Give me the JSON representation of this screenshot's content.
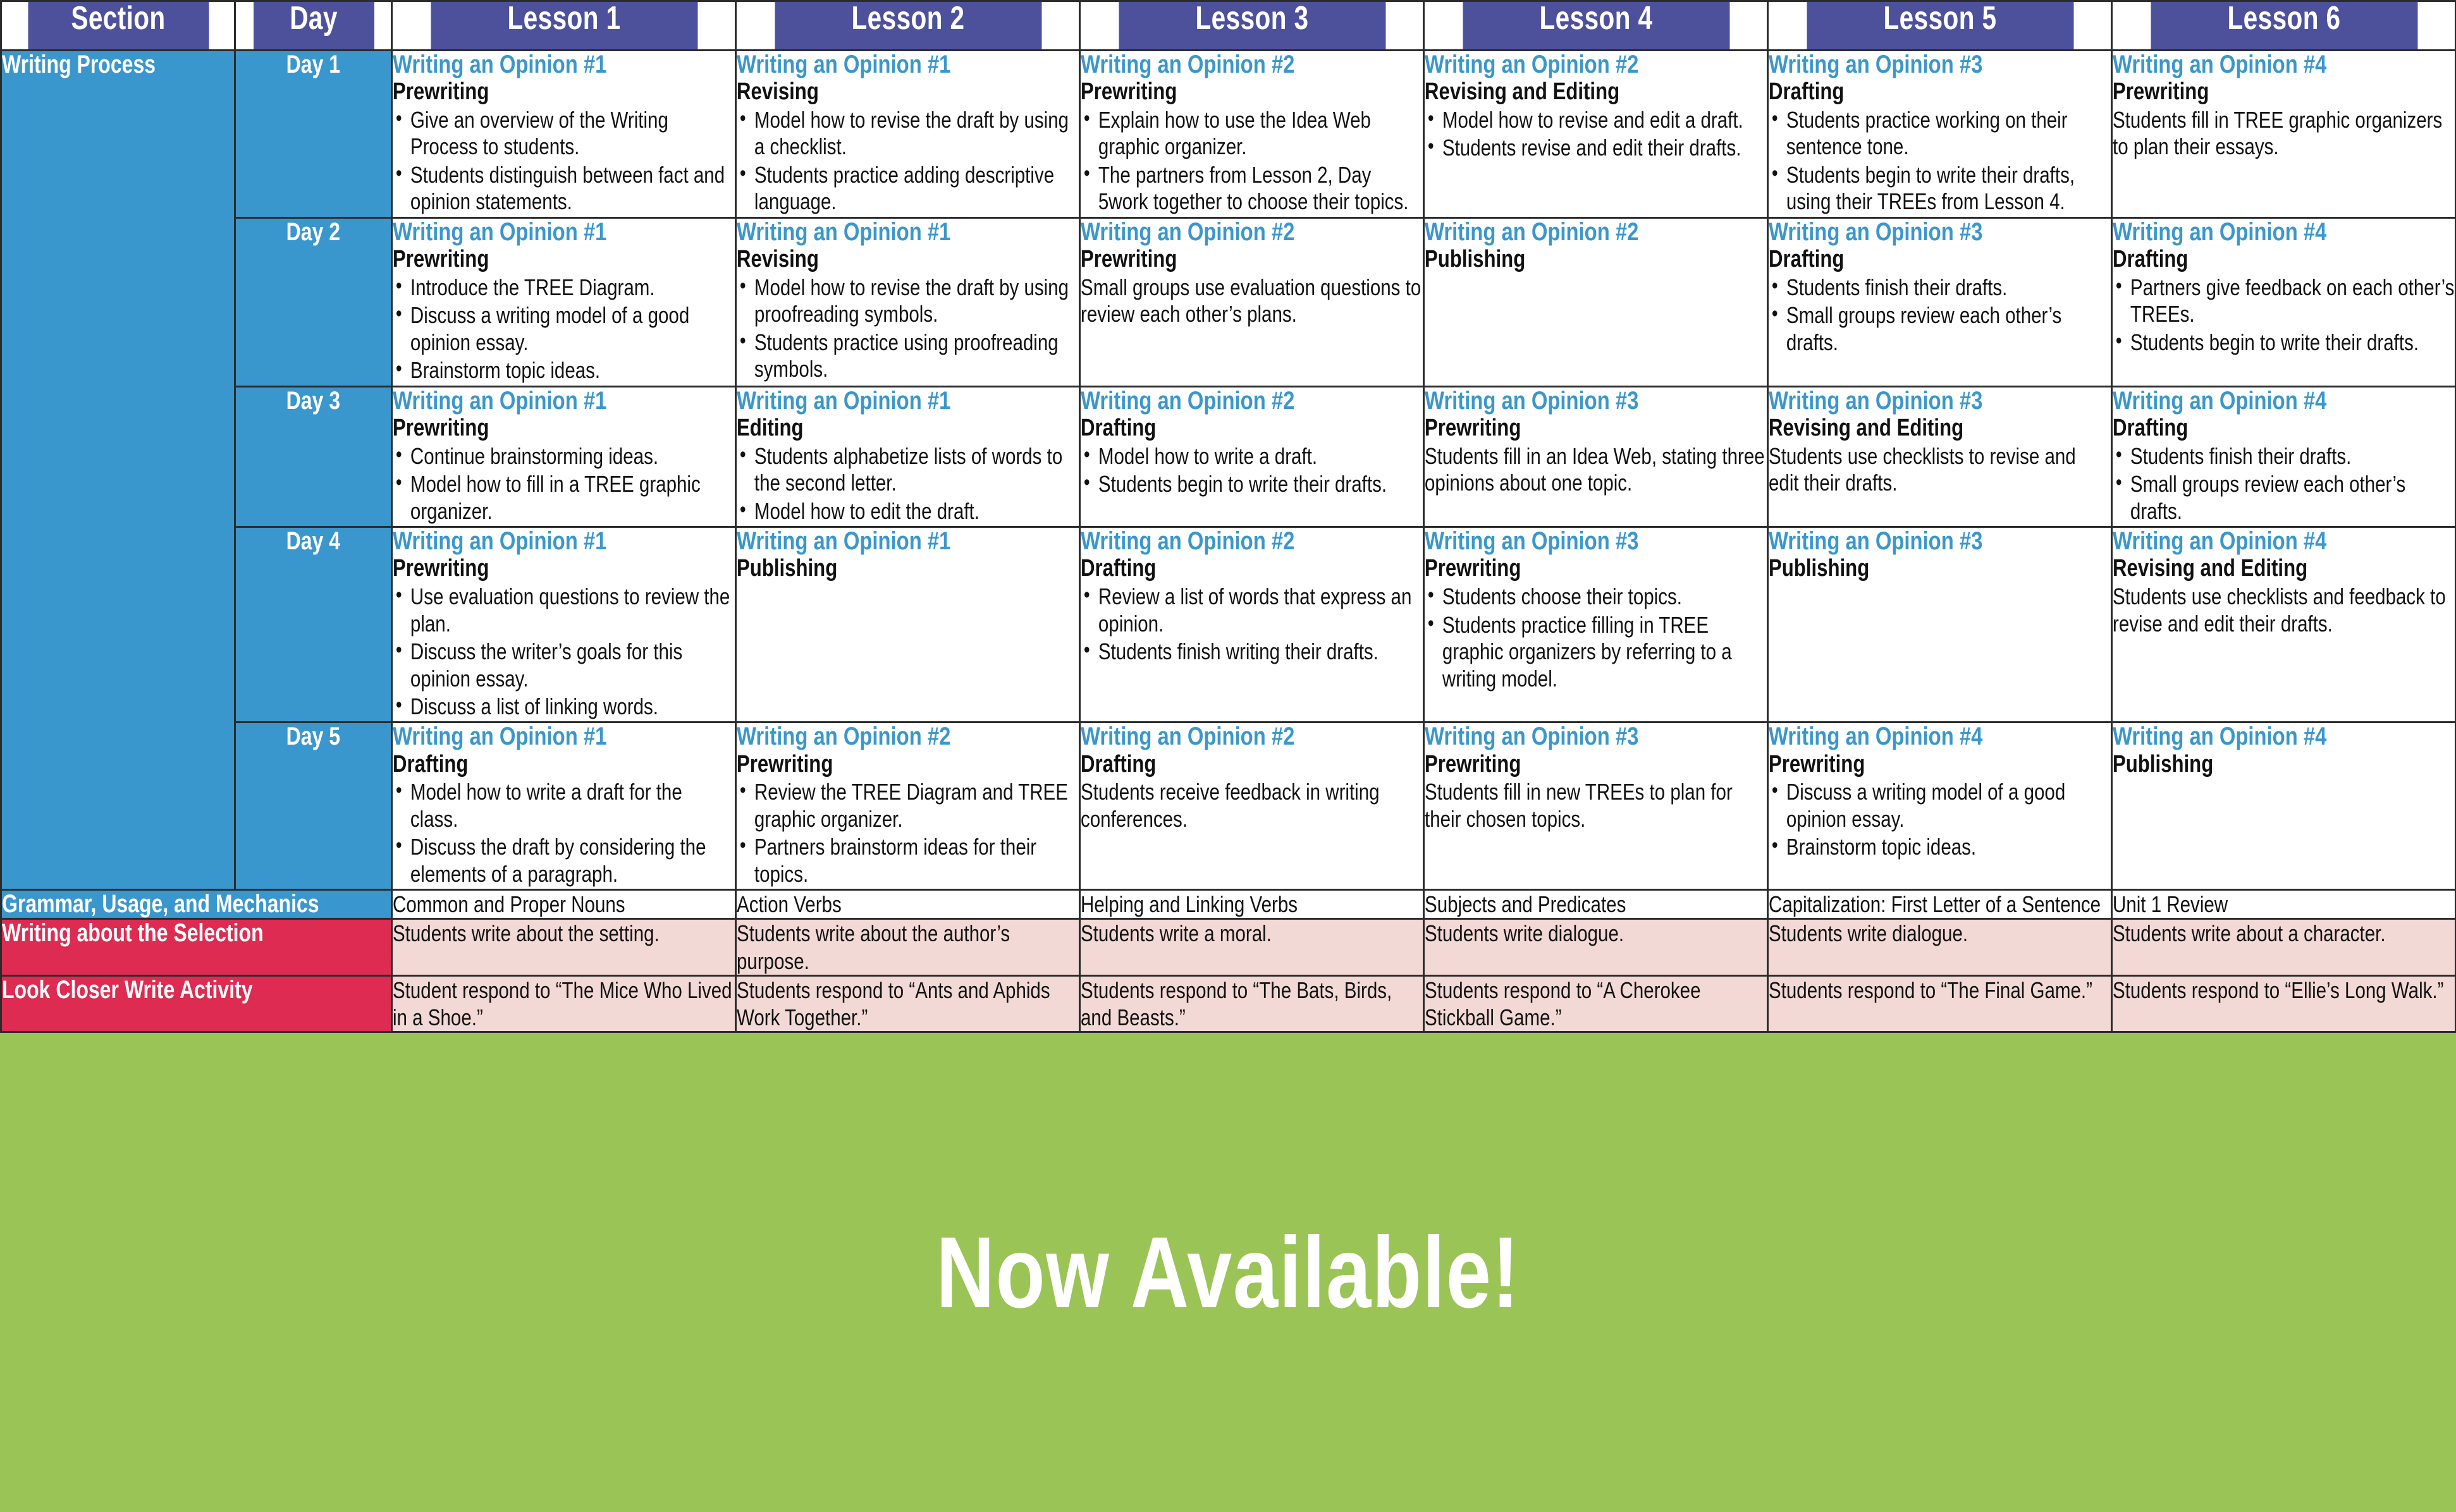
{
  "colors": {
    "header_purple": "#4d519c",
    "section_blue": "#3a97cd",
    "section_crimson": "#dd2b51",
    "pink_row": "#f3d9d6",
    "banner_green": "#9ac455",
    "title_blue": "#3a97cd"
  },
  "table": {
    "headers": [
      "Section",
      "Day",
      "Lesson 1",
      "Lesson 2",
      "Lesson 3",
      "Lesson 4",
      "Lesson 5",
      "Lesson 6"
    ],
    "writing_process": {
      "section_label": "Writing Process",
      "days": [
        {
          "day": "Day 1",
          "cells": [
            {
              "title": "Writing an Opinion #1",
              "stage": "Prewriting",
              "bullets": [
                "Give an overview of the Writing Process to students.",
                "Students distinguish between fact and opinion statements."
              ],
              "note": ""
            },
            {
              "title": "Writing an Opinion #1",
              "stage": "Revising",
              "bullets": [
                "Model how to revise the draft by using a checklist.",
                "Students practice adding descriptive language."
              ],
              "note": ""
            },
            {
              "title": "Writing an Opinion #2",
              "stage": "Prewriting",
              "bullets": [
                "Explain how to use the Idea Web graphic organizer.",
                "The partners from Lesson 2, Day 5work together to choose their topics."
              ],
              "note": ""
            },
            {
              "title": "Writing an Opinion #2",
              "stage": "Revising and Editing",
              "bullets": [
                "Model how to revise and edit a draft.",
                "Students revise and edit their drafts."
              ],
              "note": ""
            },
            {
              "title": "Writing an Opinion #3",
              "stage": "Drafting",
              "bullets": [
                "Students practice working on their sentence tone.",
                "Students begin to write their drafts, using their TREEs from Lesson 4."
              ],
              "note": ""
            },
            {
              "title": "Writing an Opinion #4",
              "stage": "Prewriting",
              "bullets": [],
              "note": "Students fill in TREE graphic organizers to plan their essays."
            }
          ]
        },
        {
          "day": "Day 2",
          "cells": [
            {
              "title": "Writing an Opinion #1",
              "stage": "Prewriting",
              "bullets": [
                "Introduce the TREE Diagram.",
                "Discuss a writing model of a good opinion essay.",
                "Brainstorm topic ideas."
              ],
              "note": ""
            },
            {
              "title": "Writing an Opinion #1",
              "stage": "Revising",
              "bullets": [
                "Model how to revise the draft by using proofreading symbols.",
                "Students practice using proofreading symbols."
              ],
              "note": ""
            },
            {
              "title": "Writing an Opinion #2",
              "stage": "Prewriting",
              "bullets": [],
              "note": "Small groups use evaluation questions to review each other’s plans."
            },
            {
              "title": "Writing an Opinion #2",
              "stage": "Publishing",
              "bullets": [],
              "note": ""
            },
            {
              "title": "Writing an Opinion #3",
              "stage": "Drafting",
              "bullets": [
                "Students finish their drafts.",
                "Small groups review each other’s drafts."
              ],
              "note": ""
            },
            {
              "title": "Writing an Opinion #4",
              "stage": "Drafting",
              "bullets": [
                "Partners give feedback on each other’s TREEs.",
                "Students begin to write their drafts."
              ],
              "note": ""
            }
          ]
        },
        {
          "day": "Day 3",
          "cells": [
            {
              "title": "Writing an Opinion #1",
              "stage": "Prewriting",
              "bullets": [
                "Continue brainstorming ideas.",
                "Model how to fill in a TREE graphic organizer."
              ],
              "note": ""
            },
            {
              "title": "Writing an Opinion #1",
              "stage": "Editing",
              "bullets": [
                "Students alphabetize lists of words to the second letter.",
                "Model how to edit the draft."
              ],
              "note": ""
            },
            {
              "title": "Writing an Opinion #2",
              "stage": "Drafting",
              "bullets": [
                "Model how to write a draft.",
                "Students begin to write their drafts."
              ],
              "note": ""
            },
            {
              "title": "Writing an Opinion #3",
              "stage": "Prewriting",
              "bullets": [],
              "note": "Students fill in an Idea Web, stating three opinions about one topic."
            },
            {
              "title": "Writing an Opinion #3",
              "stage": "Revising and Editing",
              "bullets": [],
              "note": "Students use checklists to revise and edit their drafts."
            },
            {
              "title": "Writing an Opinion #4",
              "stage": "Drafting",
              "bullets": [
                "Students finish their drafts.",
                "Small groups review each other’s drafts."
              ],
              "note": ""
            }
          ]
        },
        {
          "day": "Day 4",
          "cells": [
            {
              "title": "Writing an Opinion #1",
              "stage": "Prewriting",
              "bullets": [
                "Use evaluation questions to review the plan.",
                "Discuss the writer’s goals for this opinion essay.",
                "Discuss a list of linking words."
              ],
              "note": ""
            },
            {
              "title": "Writing an Opinion #1",
              "stage": "Publishing",
              "bullets": [],
              "note": ""
            },
            {
              "title": "Writing an Opinion #2",
              "stage": "Drafting",
              "bullets": [
                "Review a list of words that express an opinion.",
                "Students finish writing their drafts."
              ],
              "note": ""
            },
            {
              "title": "Writing an Opinion #3",
              "stage": "Prewriting",
              "bullets": [
                "Students choose their topics.",
                "Students practice filling in TREE graphic organizers by referring to a writing model."
              ],
              "note": ""
            },
            {
              "title": "Writing an Opinion #3",
              "stage": "Publishing",
              "bullets": [],
              "note": ""
            },
            {
              "title": "Writing an Opinion #4",
              "stage": "Revising and Editing",
              "bullets": [],
              "note": "Students use checklists and feedback to revise and edit their drafts."
            }
          ]
        },
        {
          "day": "Day 5",
          "cells": [
            {
              "title": "Writing an Opinion #1",
              "stage": "Drafting",
              "bullets": [
                "Model how to write a draft for the class.",
                "Discuss the draft by considering the elements of a paragraph."
              ],
              "note": ""
            },
            {
              "title": "Writing an Opinion #2",
              "stage": "Prewriting",
              "bullets": [
                "Review the TREE Diagram and TREE graphic organizer.",
                "Partners brainstorm ideas for their topics."
              ],
              "note": ""
            },
            {
              "title": "Writing an Opinion #2",
              "stage": "Drafting",
              "bullets": [],
              "note": "Students receive feedback in writing conferences."
            },
            {
              "title": "Writing an Opinion #3",
              "stage": "Prewriting",
              "bullets": [],
              "note": "Students fill in new TREEs to plan for their chosen topics."
            },
            {
              "title": "Writing an Opinion #4",
              "stage": "Prewriting",
              "bullets": [
                "Discuss a writing model of a good opinion essay.",
                "Brainstorm topic ideas."
              ],
              "note": ""
            },
            {
              "title": "Writing an Opinion #4",
              "stage": "Publishing",
              "bullets": [],
              "note": ""
            }
          ]
        }
      ]
    },
    "bottom_rows": [
      {
        "label": "Grammar, Usage, and Mechanics",
        "label_style": "blue",
        "body_style": "white",
        "cells": [
          "Common and Proper Nouns",
          "Action Verbs",
          "Helping and Linking Verbs",
          "Subjects and Predicates",
          "Capitalization: First Letter of a Sentence",
          "Unit 1 Review"
        ]
      },
      {
        "label": "Writing about the Selection",
        "label_style": "crimson",
        "body_style": "pink",
        "cells": [
          "Students write about the setting.",
          "Students write about the author’s purpose.",
          "Students write a moral.",
          "Students write dialogue.",
          "Students write dialogue.",
          "Students write about a character."
        ]
      },
      {
        "label": "Look Closer Write Activity",
        "label_style": "crimson",
        "body_style": "pink",
        "cells": [
          "Student respond to “The Mice Who Lived in a Shoe.”",
          "Students respond to “Ants and Aphids Work Together.”",
          "Students respond to “The Bats, Birds, and Beasts.”",
          "Students respond to “A Cherokee Stickball Game.”",
          "Students respond to “The Final Game.”",
          "Students respond to “Ellie’s Long Walk.”"
        ]
      }
    ]
  },
  "banner": {
    "text": "Now Available!"
  }
}
